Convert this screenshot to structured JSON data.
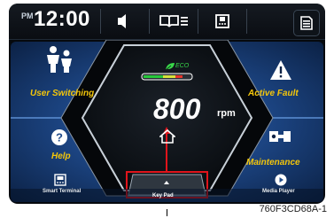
{
  "status_bar": {
    "ampm": "PM",
    "time": "12:00",
    "icons": [
      "speaker-icon",
      "book-list-icon",
      "phone-icon",
      "menu-icon"
    ]
  },
  "tiles": {
    "user_switching": "User Switching",
    "active_fault": "Active Fault",
    "help": "Help",
    "maintenance": "Maintenance",
    "smart_terminal": "Smart Terminal",
    "media_player": "Media Player"
  },
  "gauge": {
    "eco_label": "ECO",
    "rpm_value": "800",
    "rpm_unit": "rpm",
    "eco_level_fraction": 0.7
  },
  "keypad": {
    "label": "Key Pad"
  },
  "colors": {
    "accent_yellow": "#f4c60a",
    "highlight_red": "#e0141b",
    "eco_green": "#39d84a",
    "tile_blue": "#1f4a8a"
  },
  "caption": "760F3CD68A-1"
}
